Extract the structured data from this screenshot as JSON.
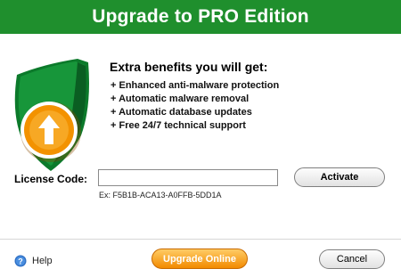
{
  "header": {
    "title": "Upgrade to PRO Edition"
  },
  "benefits": {
    "title": "Extra benefits you will get:",
    "items": [
      "+ Enhanced anti-malware protection",
      "+ Automatic malware removal",
      "+ Automatic database updates",
      "+ Free 24/7 technical support"
    ]
  },
  "license": {
    "label": "License Code:",
    "value": "",
    "example": "Ex: F5B1B-ACA13-A0FFB-5DD1A",
    "activate_label": "Activate"
  },
  "footer": {
    "help_label": "Help",
    "upgrade_label": "Upgrade Online",
    "cancel_label": "Cancel"
  },
  "icons": {
    "shield": "shield-upgrade-icon",
    "help": "help-icon"
  },
  "colors": {
    "header_bg": "#1f8f2d",
    "shield_green": "#0c7a2b",
    "badge_orange": "#f39200",
    "button_orange": "#f28a00"
  }
}
